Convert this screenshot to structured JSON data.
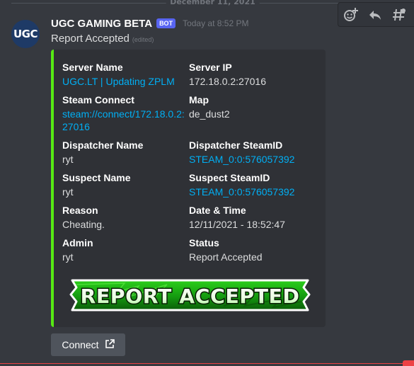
{
  "date_divider": "December 11, 2021",
  "message": {
    "avatar_text": "UGC",
    "username": "UGC GAMING BETA",
    "badge": "BOT",
    "timestamp": "Today at 8:52 PM",
    "content": "Report Accepted",
    "edited": "(edited)"
  },
  "embed": {
    "color": "#57e914",
    "fields": [
      {
        "name": "Server Name",
        "value": "UGC.LT | Updating ZPLM",
        "link": true
      },
      {
        "name": "Server IP",
        "value": "172.18.0.2:27016",
        "link": false
      },
      {
        "name": "Steam Connect",
        "value_line1": "steam://connect/172.18.0.2:",
        "value_line2": "27016",
        "link": true
      },
      {
        "name": "Map",
        "value": "de_dust2",
        "link": false
      },
      {
        "name": "Dispatcher Name",
        "value": "ryt",
        "link": false
      },
      {
        "name": "Dispatcher SteamID",
        "value": "STEAM_0:0:576057392",
        "link": true
      },
      {
        "name": "Suspect Name",
        "value": "ryt",
        "link": false
      },
      {
        "name": "Suspect SteamID",
        "value": "STEAM_0:0:576057392",
        "link": true
      },
      {
        "name": "Reason",
        "value": "Cheating.",
        "link": false
      },
      {
        "name": "Date & Time",
        "value": "12/11/2021 - 18:52:47",
        "link": false
      },
      {
        "name": "Admin",
        "value": "ryt",
        "link": false
      },
      {
        "name": "Status",
        "value": "Report Accepted",
        "link": false
      }
    ],
    "image_text": "REPORT ACCEPTED"
  },
  "button": {
    "label": "Connect",
    "icon": "external-link-icon"
  },
  "icons": {
    "hover_bar": [
      "add-reaction-icon",
      "reply-icon",
      "create-thread-icon"
    ]
  }
}
